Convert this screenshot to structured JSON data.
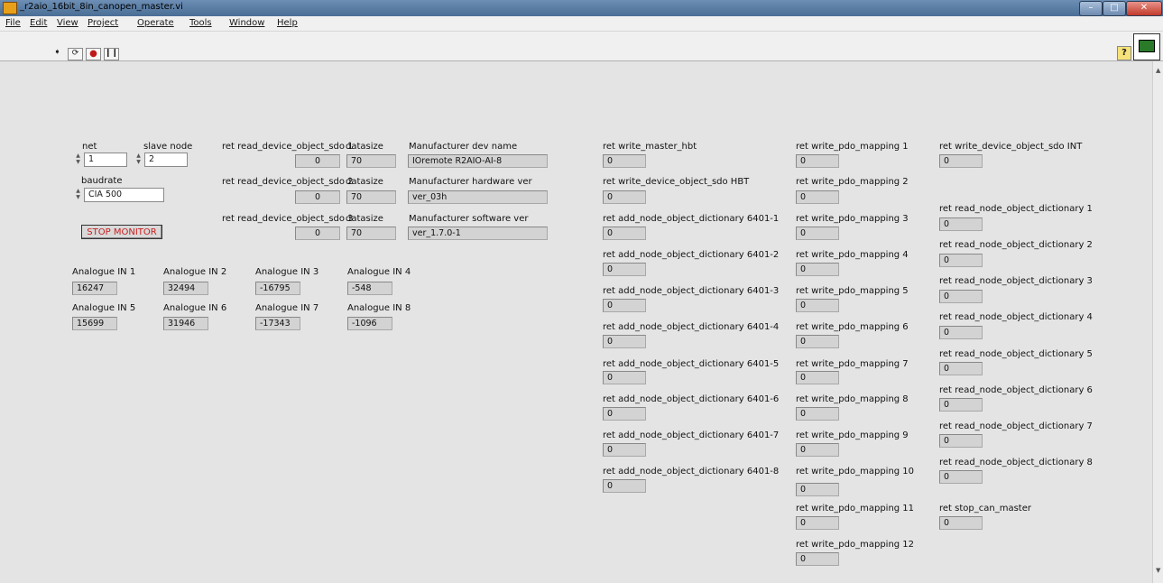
{
  "window": {
    "title": "_r2aio_16bit_8in_canopen_master.vi"
  },
  "menu": [
    "File",
    "Edit",
    "View",
    "Project",
    "Operate",
    "Tools",
    "Window",
    "Help"
  ],
  "toolbar": {
    "run_icon": "run-arrow-icon",
    "run_continuous_icon": "run-continuously-icon",
    "abort_icon": "abort-icon",
    "pause_icon": "pause-icon",
    "help_label": "?"
  },
  "controls": {
    "net_label": "net",
    "net_value": "1",
    "slave_node_label": "slave node",
    "slave_node_value": "2",
    "baudrate_label": "baudrate",
    "baudrate_value": "CIA 500",
    "stop_label": "STOP MONITOR"
  },
  "sdo_rows": [
    {
      "label": "ret read_device_object_sdo 1",
      "value": "0",
      "size_label": "datasize",
      "size": "70",
      "name_label": "Manufacturer dev name",
      "name": "IOremote R2AIO-AI-8"
    },
    {
      "label": "ret read_device_object_sdo 2",
      "value": "0",
      "size_label": "datasize",
      "size": "70",
      "name_label": "Manufacturer hardware ver",
      "name": "ver_03h"
    },
    {
      "label": "ret read_device_object_sdo 3",
      "value": "0",
      "size_label": "datasize",
      "size": "70",
      "name_label": "Manufacturer software ver",
      "name": "ver_1.7.0-1"
    }
  ],
  "analogue": [
    {
      "label": "Analogue IN 1",
      "value": "16247"
    },
    {
      "label": "Analogue IN 2",
      "value": "32494"
    },
    {
      "label": "Analogue IN 3",
      "value": "-16795"
    },
    {
      "label": "Analogue IN 4",
      "value": "-548"
    },
    {
      "label": "Analogue IN 5",
      "value": "15699"
    },
    {
      "label": "Analogue IN 6",
      "value": "31946"
    },
    {
      "label": "Analogue IN 7",
      "value": "-17343"
    },
    {
      "label": "Analogue IN 8",
      "value": "-1096"
    }
  ],
  "col1": [
    {
      "label": "ret write_master_hbt",
      "value": "0"
    },
    {
      "label": "ret write_device_object_sdo HBT",
      "value": "0"
    },
    {
      "label": "ret add_node_object_dictionary 6401-1",
      "value": "0"
    },
    {
      "label": "ret add_node_object_dictionary 6401-2",
      "value": "0"
    },
    {
      "label": "ret add_node_object_dictionary 6401-3",
      "value": "0"
    },
    {
      "label": "ret add_node_object_dictionary 6401-4",
      "value": "0"
    },
    {
      "label": "ret add_node_object_dictionary 6401-5",
      "value": "0"
    },
    {
      "label": "ret add_node_object_dictionary 6401-6",
      "value": "0"
    },
    {
      "label": "ret add_node_object_dictionary 6401-7",
      "value": "0"
    },
    {
      "label": "ret add_node_object_dictionary 6401-8",
      "value": "0"
    }
  ],
  "col2": [
    {
      "label": "ret write_pdo_mapping 1",
      "value": "0"
    },
    {
      "label": "ret write_pdo_mapping 2",
      "value": "0"
    },
    {
      "label": "ret write_pdo_mapping 3",
      "value": "0"
    },
    {
      "label": "ret write_pdo_mapping 4",
      "value": "0"
    },
    {
      "label": "ret write_pdo_mapping 5",
      "value": "0"
    },
    {
      "label": "ret write_pdo_mapping 6",
      "value": "0"
    },
    {
      "label": "ret write_pdo_mapping 7",
      "value": "0"
    },
    {
      "label": "ret write_pdo_mapping 8",
      "value": "0"
    },
    {
      "label": "ret write_pdo_mapping 9",
      "value": "0"
    },
    {
      "label": "ret write_pdo_mapping 10",
      "value": "0"
    },
    {
      "label": "ret write_pdo_mapping 11",
      "value": "0"
    },
    {
      "label": "ret write_pdo_mapping 12",
      "value": "0"
    }
  ],
  "col3_top": {
    "label": "ret write_device_object_sdo INT",
    "value": "0"
  },
  "col3": [
    {
      "label": "ret read_node_object_dictionary 1",
      "value": "0"
    },
    {
      "label": "ret read_node_object_dictionary 2",
      "value": "0"
    },
    {
      "label": "ret read_node_object_dictionary 3",
      "value": "0"
    },
    {
      "label": "ret read_node_object_dictionary 4",
      "value": "0"
    },
    {
      "label": "ret read_node_object_dictionary 5",
      "value": "0"
    },
    {
      "label": "ret read_node_object_dictionary 6",
      "value": "0"
    },
    {
      "label": "ret read_node_object_dictionary 7",
      "value": "0"
    },
    {
      "label": "ret read_node_object_dictionary 8",
      "value": "0"
    },
    {
      "label": "ret stop_can_master",
      "value": "0"
    }
  ]
}
